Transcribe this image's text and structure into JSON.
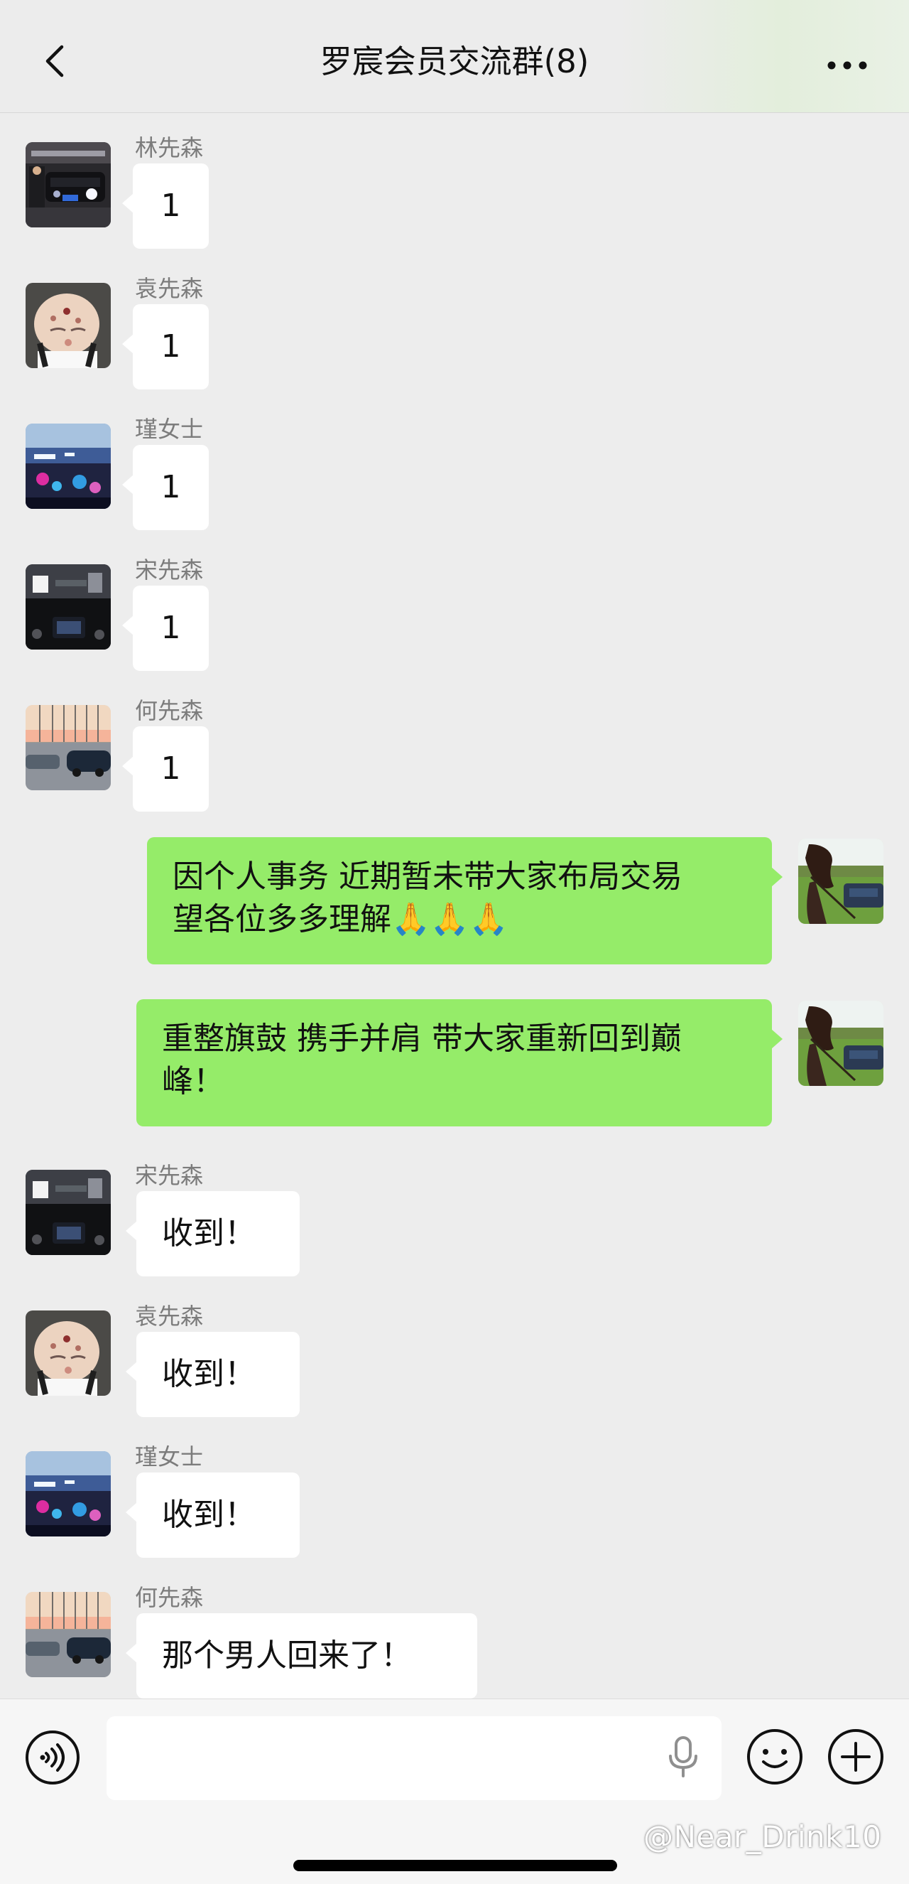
{
  "header": {
    "title": "罗宸会员交流群(8)",
    "back_icon": "chevron-left-icon",
    "more_icon": "more-dots-icon"
  },
  "messages": [
    {
      "side": "left",
      "sender": "林先森",
      "text": "1",
      "avatar": "car-night-avatar"
    },
    {
      "side": "left",
      "sender": "袁先森",
      "text": "1",
      "avatar": "baby-avatar"
    },
    {
      "side": "left",
      "sender": "瑾女士",
      "text": "1",
      "avatar": "city-lights-avatar"
    },
    {
      "side": "left",
      "sender": "宋先森",
      "text": "1",
      "avatar": "car-dashboard-avatar"
    },
    {
      "side": "left",
      "sender": "何先森",
      "text": "1",
      "avatar": "sunset-parking-avatar"
    },
    {
      "side": "right",
      "text_line1": "因个人事务 近期暂未带大家布局交易",
      "text_line2": "望各位多多理解",
      "emoji": "🙏🙏🙏",
      "avatar": "horse-avatar"
    },
    {
      "side": "right",
      "text_line1": "重整旗鼓 携手并肩 带大家重新回到巅",
      "text_line2": "峰！",
      "avatar": "horse-avatar"
    },
    {
      "side": "left",
      "sender": "宋先森",
      "text": "收到！",
      "avatar": "car-dashboard-avatar"
    },
    {
      "side": "left",
      "sender": "袁先森",
      "text": "收到！",
      "avatar": "baby-avatar"
    },
    {
      "side": "left",
      "sender": "瑾女士",
      "text": "收到！",
      "avatar": "city-lights-avatar"
    },
    {
      "side": "left",
      "sender": "何先森",
      "text": "那个男人回来了！",
      "avatar": "sunset-parking-avatar"
    }
  ],
  "input_bar": {
    "voice_icon": "voice-toggle-icon",
    "mic_icon": "microphone-icon",
    "emoji_icon": "emoji-icon",
    "plus_icon": "plus-icon",
    "input_value": ""
  },
  "watermark": "@Near_Drink10",
  "colors": {
    "background": "#ededed",
    "bubble_self": "#95ec69",
    "bubble_other": "#ffffff",
    "sender_name": "#7c7c7c"
  }
}
